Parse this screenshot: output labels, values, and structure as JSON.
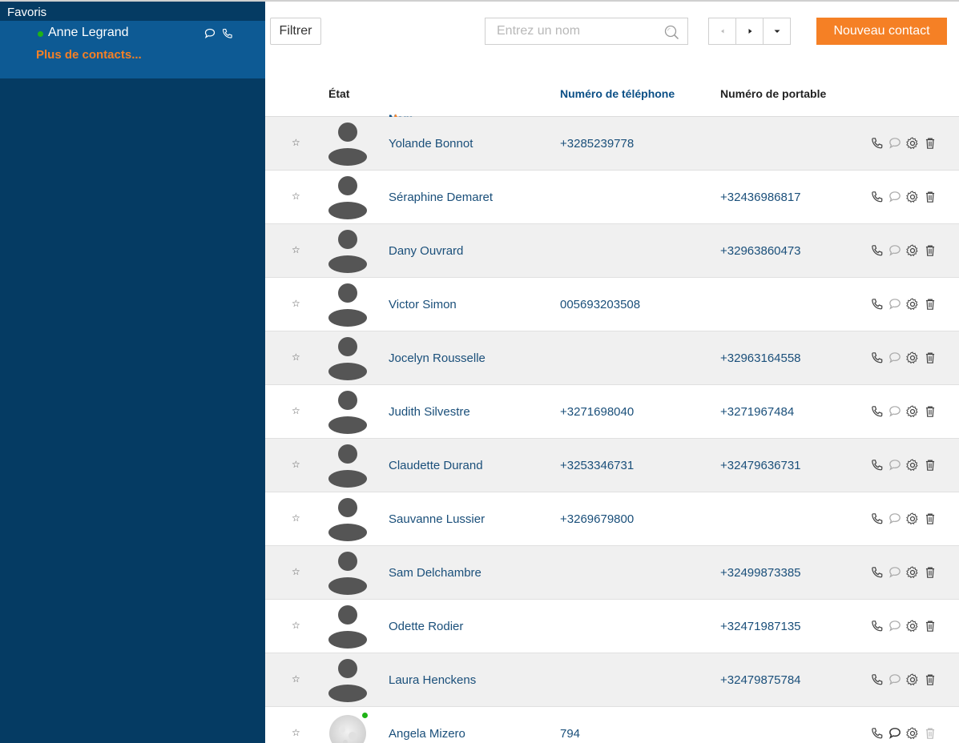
{
  "sidebar": {
    "title": "Favoris",
    "favorite": {
      "name": "Anne Legrand",
      "status_color": "#1fb316"
    },
    "more_label": "Plus de contacts..."
  },
  "toolbar": {
    "filter_label": "Filtrer",
    "search_placeholder": "Entrez un nom",
    "new_contact_label": "Nouveau contact"
  },
  "table": {
    "headers": {
      "etat": "État",
      "nom": "Nom",
      "telephone": "Numéro de téléphone",
      "portable": "Numéro de portable"
    },
    "sort_indicator": "▲",
    "rows": [
      {
        "name": "Yolande Bonnot",
        "phone": "+3285239778",
        "mobile": ""
      },
      {
        "name": "Séraphine Demaret",
        "phone": "",
        "mobile": "+32436986817"
      },
      {
        "name": "Dany Ouvrard",
        "phone": "",
        "mobile": "+32963860473"
      },
      {
        "name": "Victor Simon",
        "phone": "005693203508",
        "mobile": ""
      },
      {
        "name": "Jocelyn Rousselle",
        "phone": "",
        "mobile": "+32963164558"
      },
      {
        "name": "Judith Silvestre",
        "phone": "+3271698040",
        "mobile": "+3271967484"
      },
      {
        "name": "Claudette Durand",
        "phone": "+3253346731",
        "mobile": "+32479636731"
      },
      {
        "name": "Sauvanne Lussier",
        "phone": "+3269679800",
        "mobile": ""
      },
      {
        "name": "Sam Delchambre",
        "phone": "",
        "mobile": "+32499873385"
      },
      {
        "name": "Odette Rodier",
        "phone": "",
        "mobile": "+32471987135"
      },
      {
        "name": "Laura Henckens",
        "phone": "",
        "mobile": "+32479875784"
      },
      {
        "name": "Angela Mizero",
        "phone": "794",
        "mobile": ""
      }
    ]
  },
  "colors": {
    "sidebar_bg": "#053b63",
    "favorites_bg": "#0d5a94",
    "accent": "#f58025",
    "online": "#1fb316"
  },
  "icons": [
    "star-icon",
    "phone-icon",
    "chat-icon",
    "settings-icon",
    "trash-icon",
    "search-icon",
    "chevron-left-icon",
    "chevron-right-icon",
    "caret-down-icon"
  ]
}
